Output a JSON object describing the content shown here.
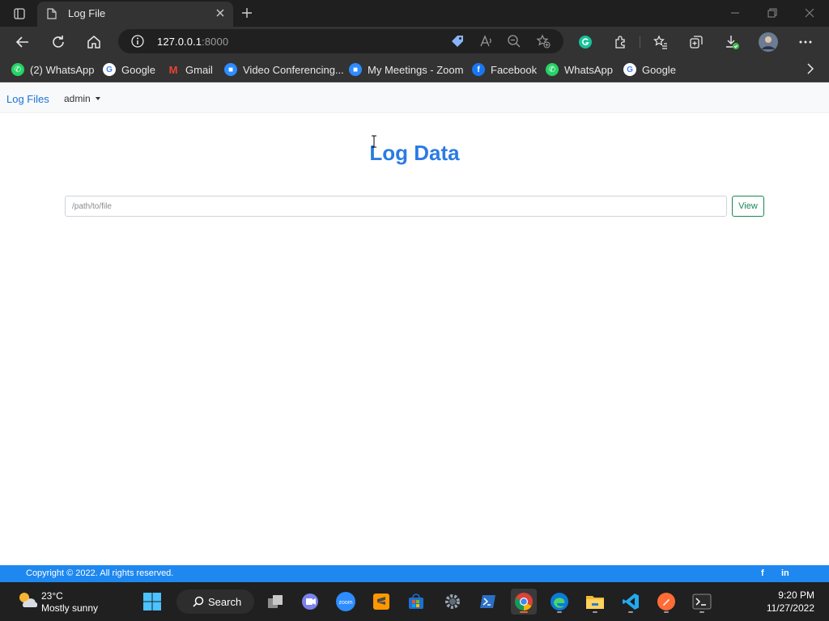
{
  "browser": {
    "tab_title": "Log File",
    "url_host": "127.0.0.1",
    "url_port": ":8000",
    "bookmarks": [
      {
        "label": "(2) WhatsApp",
        "icon": "whatsapp-icon",
        "color": "#25d366"
      },
      {
        "label": "Google",
        "icon": "google-icon",
        "color": "#ffffff"
      },
      {
        "label": "Gmail",
        "icon": "gmail-icon",
        "color": "#ea4335"
      },
      {
        "label": "Video Conferencing...",
        "icon": "zoom-icon",
        "color": "#2d8cff"
      },
      {
        "label": "My Meetings - Zoom",
        "icon": "zoom-icon",
        "color": "#2d8cff"
      },
      {
        "label": "Facebook",
        "icon": "facebook-icon",
        "color": "#1877f2"
      },
      {
        "label": "WhatsApp",
        "icon": "whatsapp-icon",
        "color": "#25d366"
      },
      {
        "label": "Google",
        "icon": "google-icon",
        "color": "#ffffff"
      }
    ]
  },
  "nav": {
    "brand": "Log Files",
    "user_menu": "admin"
  },
  "main": {
    "title": "Log Data",
    "path_placeholder": "/path/to/file",
    "view_label": "View"
  },
  "footer": {
    "copyright": "Copyright © 2022. All rights reserved.",
    "facebook_label": "f",
    "linkedin_label": "in"
  },
  "taskbar": {
    "temperature": "23°C",
    "weather": "Mostly sunny",
    "search_label": "Search",
    "time": "9:20 PM",
    "date": "11/27/2022"
  },
  "colors": {
    "brand_blue": "#2a7be4",
    "footer_blue": "#1e88f0",
    "view_green": "#198754"
  }
}
